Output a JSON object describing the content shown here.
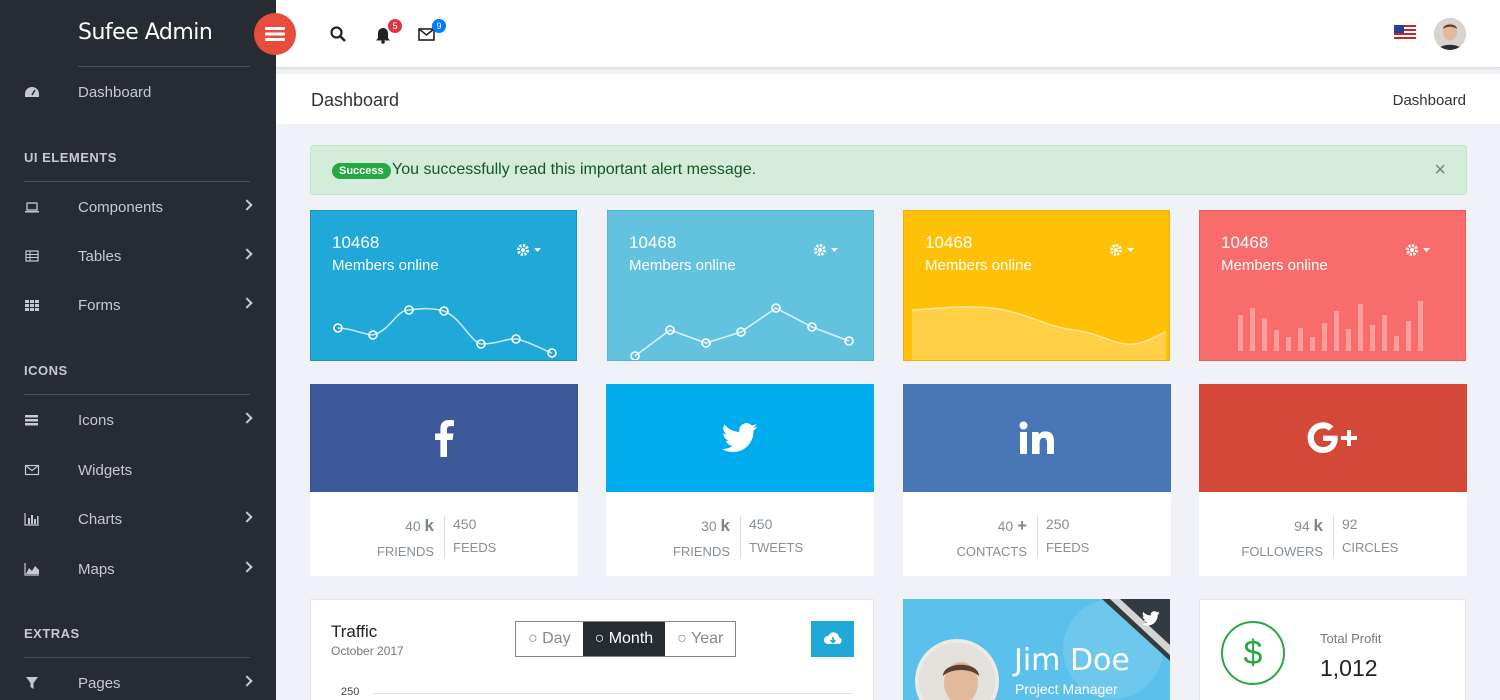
{
  "brand": {
    "name": "Sufee Admin"
  },
  "sidebar": {
    "dashboard": "Dashboard",
    "sections": [
      "UI ELEMENTS",
      "ICONS",
      "EXTRAS"
    ],
    "items": {
      "components": "Components",
      "tables": "Tables",
      "forms": "Forms",
      "icons": "Icons",
      "widgets": "Widgets",
      "charts": "Charts",
      "maps": "Maps",
      "pages": "Pages"
    }
  },
  "header": {
    "notif_count": "5",
    "mail_count": "9"
  },
  "titlebar": {
    "title": "Dashboard",
    "breadcrumb": "Dashboard"
  },
  "alert": {
    "pill": "Success",
    "message": "You successfully read this important alert message.",
    "close": "×"
  },
  "stats": [
    {
      "value": "10468",
      "label": "Members online",
      "color": "#20a8d8"
    },
    {
      "value": "10468",
      "label": "Members online",
      "color": "#63c2de"
    },
    {
      "value": "10468",
      "label": "Members online",
      "color": "#ffc107"
    },
    {
      "value": "10468",
      "label": "Members online",
      "color": "#f86c6b"
    }
  ],
  "social": [
    {
      "network": "facebook",
      "color": "#3b5998",
      "left_value": "40",
      "left_unit": "k",
      "left_caption": "FRIENDS",
      "right_value": "450",
      "right_caption": "FEEDS"
    },
    {
      "network": "twitter",
      "color": "#00aced",
      "left_value": "30",
      "left_unit": "k",
      "left_caption": "FRIENDS",
      "right_value": "450",
      "right_caption": "TWEETS"
    },
    {
      "network": "linkedin",
      "color": "#4875b4",
      "left_value": "40",
      "left_unit": "+",
      "left_caption": "CONTACTS",
      "right_value": "250",
      "right_caption": "FEEDS"
    },
    {
      "network": "google-plus",
      "color": "#d34836",
      "left_value": "94",
      "left_unit": "k",
      "left_caption": "FOLLOWERS",
      "right_value": "92",
      "right_caption": "CIRCLES"
    }
  ],
  "traffic": {
    "title": "Traffic",
    "subtitle": "October 2017",
    "options": [
      "Day",
      "Month",
      "Year"
    ],
    "selected": "Month",
    "tick": "250"
  },
  "profile": {
    "name": "Jim Doe",
    "role": "Project Manager"
  },
  "profit": {
    "label": "Total Profit",
    "value": "1,012"
  }
}
